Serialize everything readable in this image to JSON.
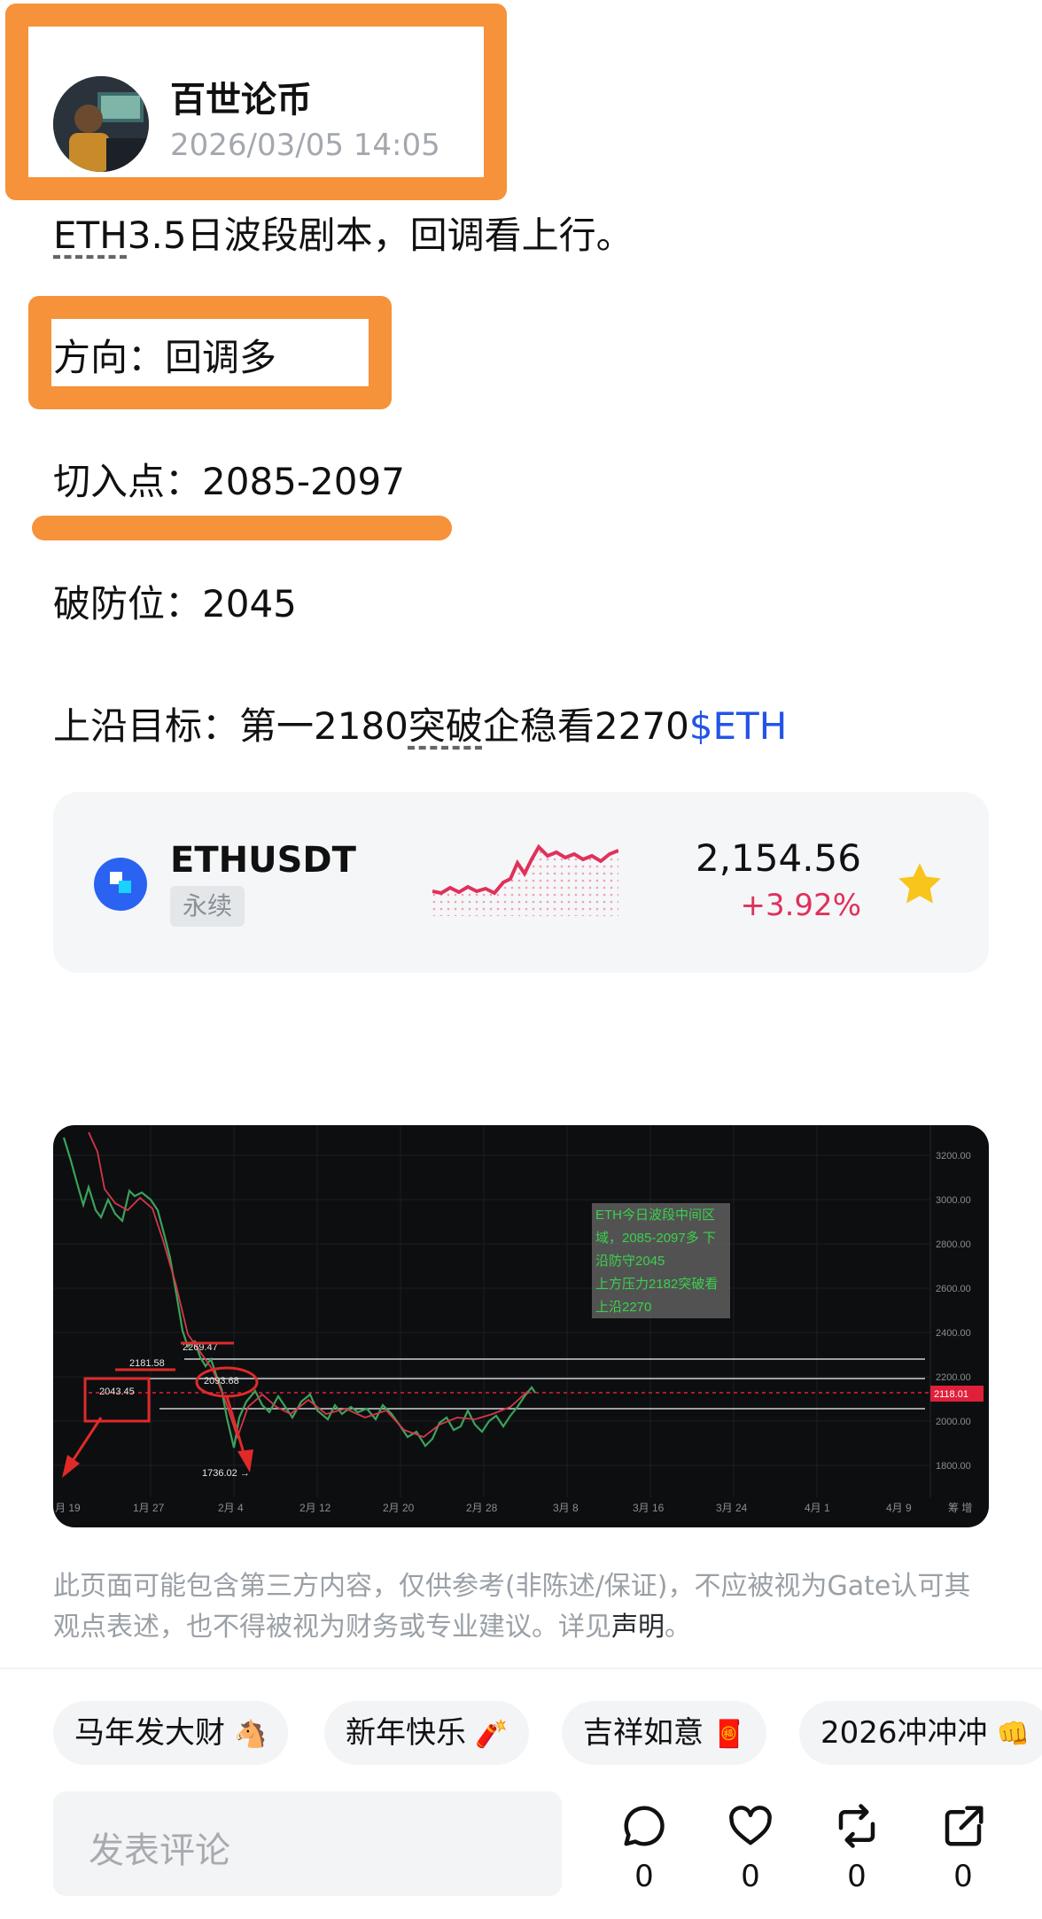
{
  "post": {
    "author": "百世论币",
    "time": "2026/03/05 14:05",
    "line1_prefix": "ETH",
    "line1_rest": "3.5日波段剧本，回调看上行。",
    "direction": "方向：回调多",
    "entry": "切入点：2085-2097",
    "stop": "破防位：2045",
    "target_a": "上沿目标：第一2180",
    "target_b": "突破",
    "target_c": "企稳看2270",
    "target_tag": "$ETH"
  },
  "ticker": {
    "symbol": "ETHUSDT",
    "type": "永续",
    "price": "2,154.56",
    "change": "+3.92%"
  },
  "chart_image": {
    "note_lines": [
      "ETH今日波段中间区",
      "域，2085-2097多 下",
      "沿防守2045",
      "上方压力2182突破看",
      "上沿2270"
    ],
    "price_labels": [
      "3200.00",
      "3000.00",
      "2800.00",
      "2600.00",
      "2400.00",
      "2200.00",
      "2000.00",
      "1800.00"
    ],
    "current_price": "2118.01",
    "date_labels": [
      "月 19",
      "1月 27",
      "2月 4",
      "2月 12",
      "2月 20",
      "2月 28",
      "3月 8",
      "3月 16",
      "3月 24",
      "4月 1",
      "4月 9",
      "筹 增"
    ],
    "level_labels": [
      "2269.47",
      "2181.58",
      "2093.68",
      "2043.45",
      "1736.02 →"
    ]
  },
  "disclaimer": {
    "text": "此页面可能包含第三方内容，仅供参考(非陈述/保证)，不应被视为Gate认可其观点表述，也不得被视为财务或专业建议。详见",
    "link": "声明",
    "end": "。"
  },
  "chips": [
    {
      "label": "马年发大财",
      "emoji": "🐴"
    },
    {
      "label": "新年快乐",
      "emoji": "🧨"
    },
    {
      "label": "吉祥如意",
      "emoji": "🧧"
    },
    {
      "label": "2026冲冲冲",
      "emoji": "👊"
    }
  ],
  "bottom": {
    "comment_placeholder": "发表评论",
    "reply_count": "0",
    "like_count": "0",
    "repost_count": "0",
    "share_count": "0"
  },
  "colors": {
    "highlight": "#f5923a",
    "link": "#2354e6",
    "down": "#e0315a",
    "star": "#f7c51c"
  }
}
